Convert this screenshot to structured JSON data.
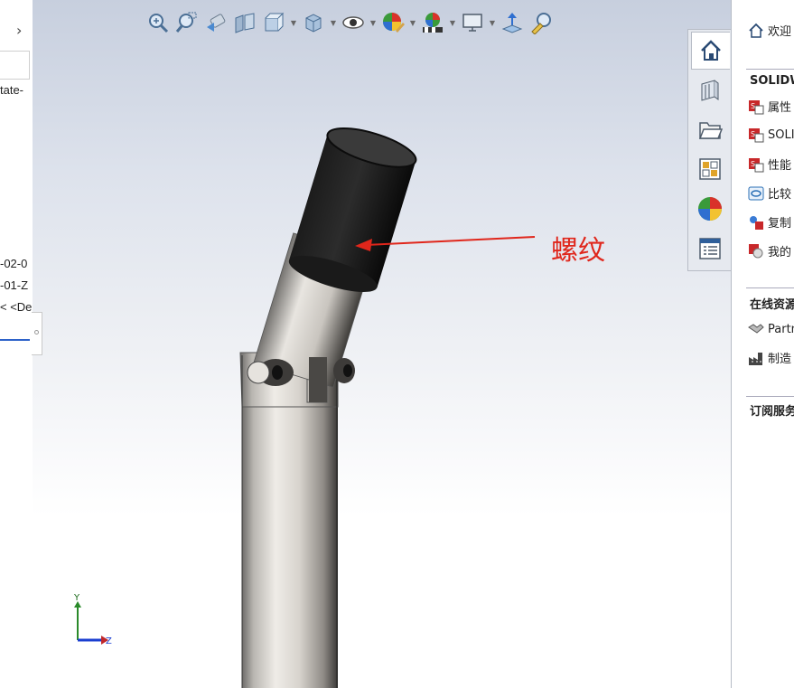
{
  "left_panel": {
    "expand_glyph": "›",
    "tree_lines": [
      "tate-",
      "-02-0",
      "-01-Z",
      "< <De"
    ]
  },
  "toolbar": {
    "buttons": [
      {
        "name": "zoom-to-fit-icon"
      },
      {
        "name": "zoom-to-area-icon"
      },
      {
        "name": "previous-view-icon"
      },
      {
        "name": "section-view-icon"
      },
      {
        "name": "view-orientation-icon",
        "dropdown": true
      },
      {
        "name": "display-style-icon",
        "dropdown": true
      },
      {
        "name": "hide-show-items-icon",
        "dropdown": true
      },
      {
        "name": "edit-appearance-icon",
        "dropdown": true
      },
      {
        "name": "apply-scene-icon",
        "dropdown": true
      },
      {
        "name": "view-settings-icon",
        "dropdown": true
      },
      {
        "name": "rotate-view-icon"
      },
      {
        "name": "measure-icon"
      }
    ]
  },
  "viewport": {
    "annotation_text": "螺纹",
    "annotation_color": "#e0261b",
    "triad": {
      "y_label": "Y",
      "z_label": "Z"
    }
  },
  "task_tabs": [
    {
      "name": "home-tab-icon",
      "active": true
    },
    {
      "name": "design-library-tab-icon"
    },
    {
      "name": "file-explorer-tab-icon"
    },
    {
      "name": "view-palette-tab-icon"
    },
    {
      "name": "appearances-tab-icon"
    },
    {
      "name": "custom-properties-tab-icon"
    }
  ],
  "task_pane": {
    "welcome": "欢迎",
    "section1_title": "SOLIDW",
    "items1": [
      "属性",
      "SOLI",
      "性能",
      "比较",
      "复制",
      "我的"
    ],
    "section2_title": "在线资源",
    "items2": [
      "Partn",
      "制造"
    ],
    "section3_title": "订阅服务"
  }
}
